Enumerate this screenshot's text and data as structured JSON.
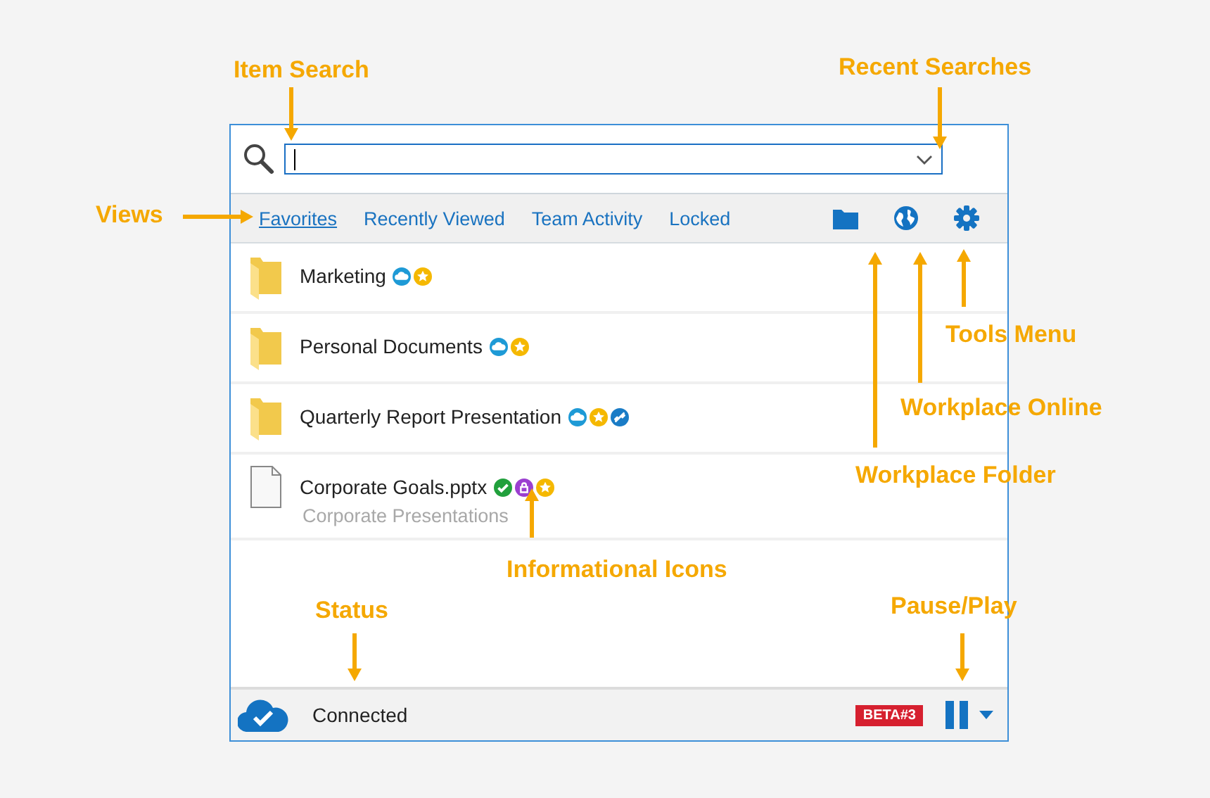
{
  "search": {
    "focused": true
  },
  "tabs": [
    {
      "label": "Favorites",
      "selected": true
    },
    {
      "label": "Recently Viewed",
      "selected": false
    },
    {
      "label": "Team Activity",
      "selected": false
    },
    {
      "label": "Locked",
      "selected": false
    }
  ],
  "items": [
    {
      "kind": "folder",
      "name": "Marketing",
      "icons": [
        {
          "kind": "cloud"
        },
        {
          "kind": "star"
        }
      ]
    },
    {
      "kind": "folder",
      "name": "Personal Documents",
      "icons": [
        {
          "kind": "cloud"
        },
        {
          "kind": "star"
        }
      ]
    },
    {
      "kind": "folder",
      "name": "Quarterly Report Presentation",
      "icons": [
        {
          "kind": "cloud"
        },
        {
          "kind": "star"
        },
        {
          "kind": "link"
        }
      ]
    },
    {
      "kind": "file",
      "name": "Corporate Goals.pptx",
      "subtitle": "Corporate Presentations",
      "icons": [
        {
          "kind": "check"
        },
        {
          "kind": "lock"
        },
        {
          "kind": "star"
        }
      ]
    }
  ],
  "status": {
    "text": "Connected",
    "badge": "BETA#3"
  },
  "annotations": [
    "Item Search",
    "Recent Searches",
    "Views",
    "Tools Menu",
    "Workplace Online",
    "Workplace Folder",
    "Informational Icons",
    "Status",
    "Pause/Play"
  ]
}
